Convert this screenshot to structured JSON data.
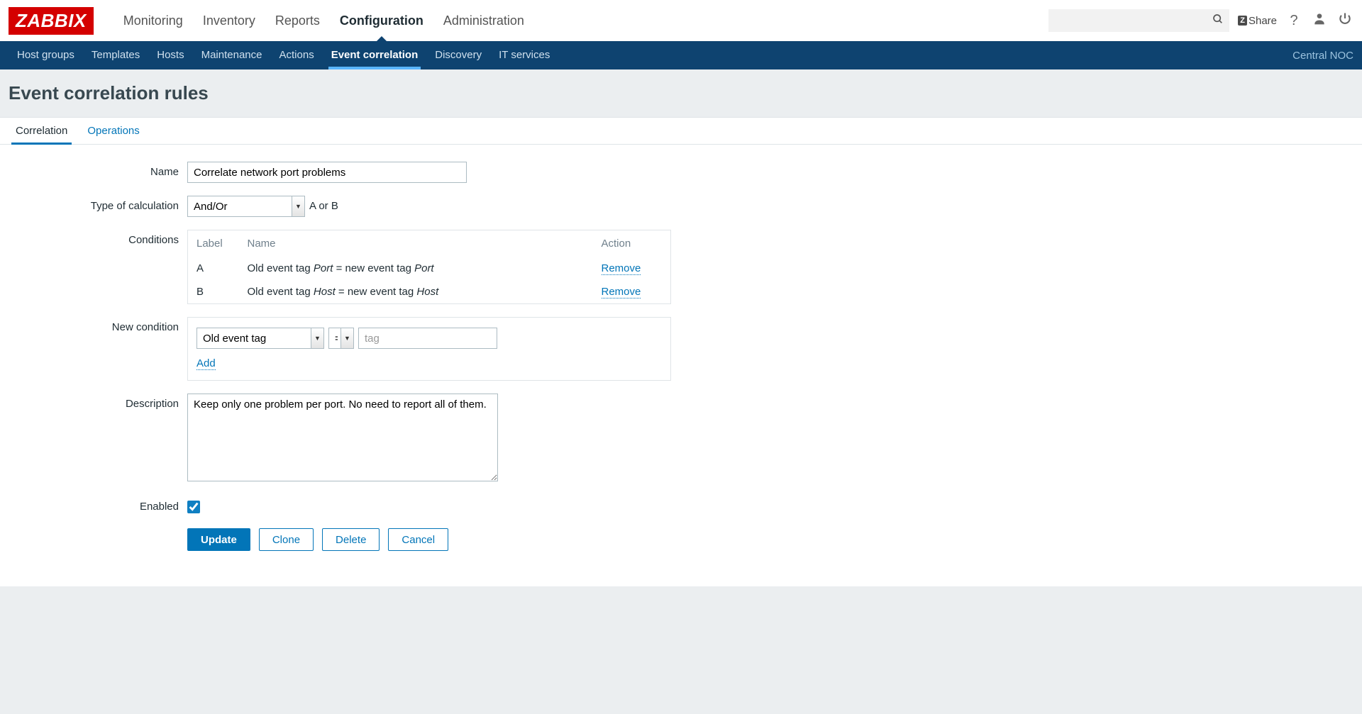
{
  "logo_text": "ZABBIX",
  "topnav": {
    "items": [
      {
        "label": "Monitoring"
      },
      {
        "label": "Inventory"
      },
      {
        "label": "Reports"
      },
      {
        "label": "Configuration",
        "active": true
      },
      {
        "label": "Administration"
      }
    ]
  },
  "search": {
    "placeholder": ""
  },
  "share_label": "Share",
  "subnav": {
    "items": [
      {
        "label": "Host groups"
      },
      {
        "label": "Templates"
      },
      {
        "label": "Hosts"
      },
      {
        "label": "Maintenance"
      },
      {
        "label": "Actions"
      },
      {
        "label": "Event correlation",
        "active": true
      },
      {
        "label": "Discovery"
      },
      {
        "label": "IT services"
      }
    ],
    "right_label": "Central NOC"
  },
  "page_title": "Event correlation rules",
  "tabs": [
    {
      "label": "Correlation",
      "active": true
    },
    {
      "label": "Operations"
    }
  ],
  "form": {
    "labels": {
      "name": "Name",
      "type_of_calculation": "Type of calculation",
      "conditions": "Conditions",
      "new_condition": "New condition",
      "description": "Description",
      "enabled": "Enabled"
    },
    "name_value": "Correlate network port problems",
    "type_of_calc_selected": "And/Or",
    "calc_expression": "A or B",
    "conditions_table": {
      "headers": {
        "label": "Label",
        "name": "Name",
        "action": "Action"
      },
      "rows": [
        {
          "label": "A",
          "text_prefix1": "Old event tag ",
          "tag1": "Port",
          "text_mid": " = new event tag ",
          "tag2": "Port",
          "action": "Remove"
        },
        {
          "label": "B",
          "text_prefix1": "Old event tag ",
          "tag1": "Host",
          "text_mid": " = new event tag ",
          "tag2": "Host",
          "action": "Remove"
        }
      ]
    },
    "new_condition": {
      "type_selected": "Old event tag",
      "operator_selected": "=",
      "tag_placeholder": "tag",
      "add_label": "Add"
    },
    "description_value": "Keep only one problem per port. No need to report all of them.",
    "enabled_checked": true,
    "buttons": {
      "update": "Update",
      "clone": "Clone",
      "delete": "Delete",
      "cancel": "Cancel"
    }
  }
}
